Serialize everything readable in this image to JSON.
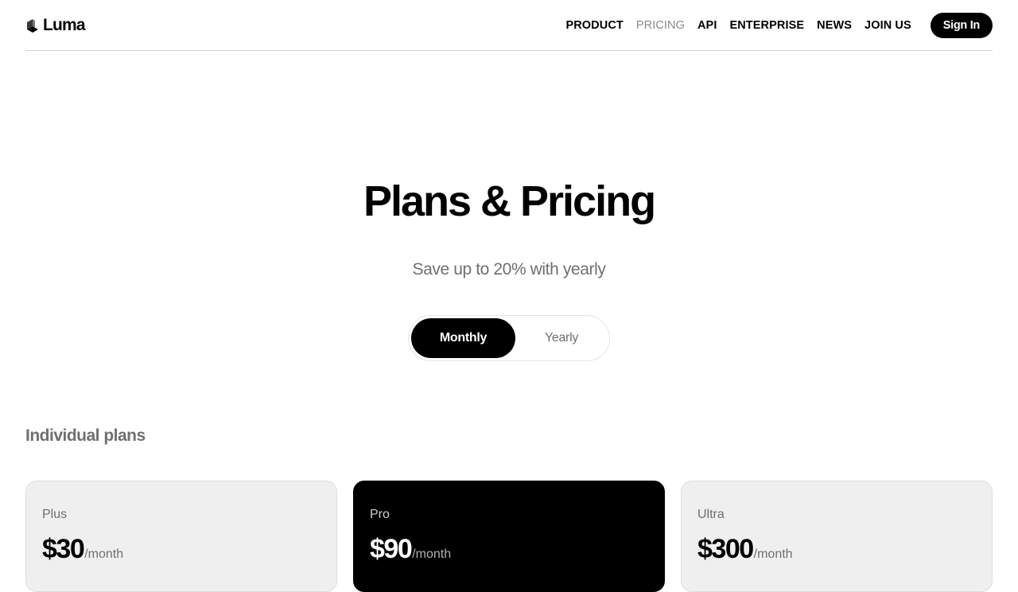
{
  "brand": {
    "name": "Luma",
    "icon": "cube-logo-icon"
  },
  "nav": {
    "items": [
      {
        "label": "PRODUCT",
        "active": false
      },
      {
        "label": "PRICING",
        "active": true
      },
      {
        "label": "API",
        "active": false
      },
      {
        "label": "ENTERPRISE",
        "active": false
      },
      {
        "label": "NEWS",
        "active": false
      },
      {
        "label": "JOIN US",
        "active": false
      }
    ],
    "signin_label": "Sign In"
  },
  "hero": {
    "title": "Plans & Pricing",
    "subtitle": "Save up to 20% with yearly"
  },
  "billing_toggle": {
    "options": [
      "Monthly",
      "Yearly"
    ],
    "selected": "Monthly"
  },
  "plans_section": {
    "title": "Individual plans",
    "plans": [
      {
        "name": "Plus",
        "price": "$30",
        "period": "/month",
        "highlighted": false
      },
      {
        "name": "Pro",
        "price": "$90",
        "period": "/month",
        "highlighted": true
      },
      {
        "name": "Ultra",
        "price": "$300",
        "period": "/month",
        "highlighted": false
      }
    ]
  },
  "colors": {
    "accent": "#000000",
    "muted_text": "#6f6f6f",
    "card_bg": "#efefef"
  }
}
